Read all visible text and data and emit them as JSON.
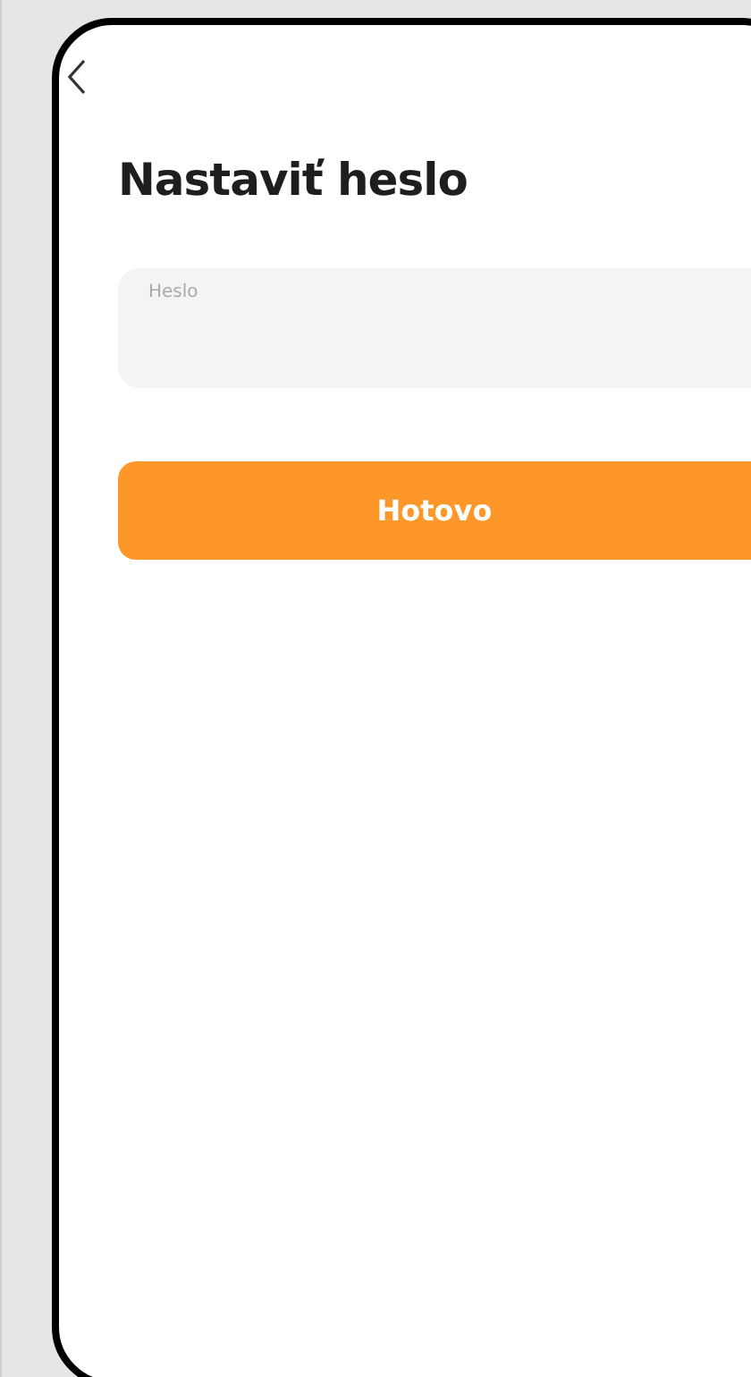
{
  "screen": {
    "title": "Nastaviť heslo"
  },
  "password_field": {
    "label": "Heslo"
  },
  "done_button": {
    "label": "Hotovo"
  }
}
